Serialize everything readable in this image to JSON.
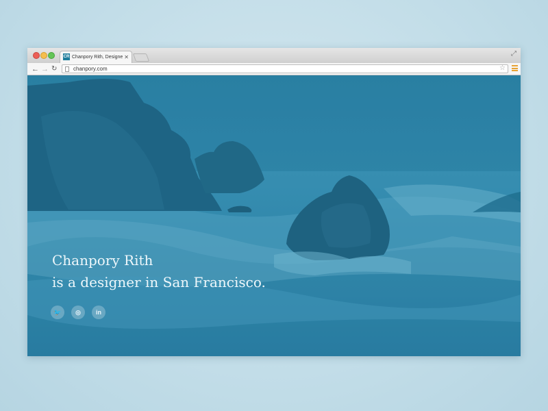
{
  "browser": {
    "tab": {
      "favicon_text": "CR",
      "title": "Chanpory Rith, Designer in",
      "close_glyph": "✕"
    },
    "url": "chanpory.com",
    "icons": [
      "back-arrow-icon",
      "forward-arrow-icon",
      "reload-icon",
      "page-icon",
      "star-icon",
      "menu-icon",
      "fullscreen-icon"
    ]
  },
  "hero": {
    "line1": "Chanpory Rith",
    "line2": "is a designer in San Francisco."
  },
  "social": {
    "twitter_glyph": "🐦",
    "dribbble_glyph": "◎",
    "linkedin_glyph": "in"
  },
  "colors": {
    "overlay": "#2f83a6",
    "accent_menu": "#e8a232"
  }
}
